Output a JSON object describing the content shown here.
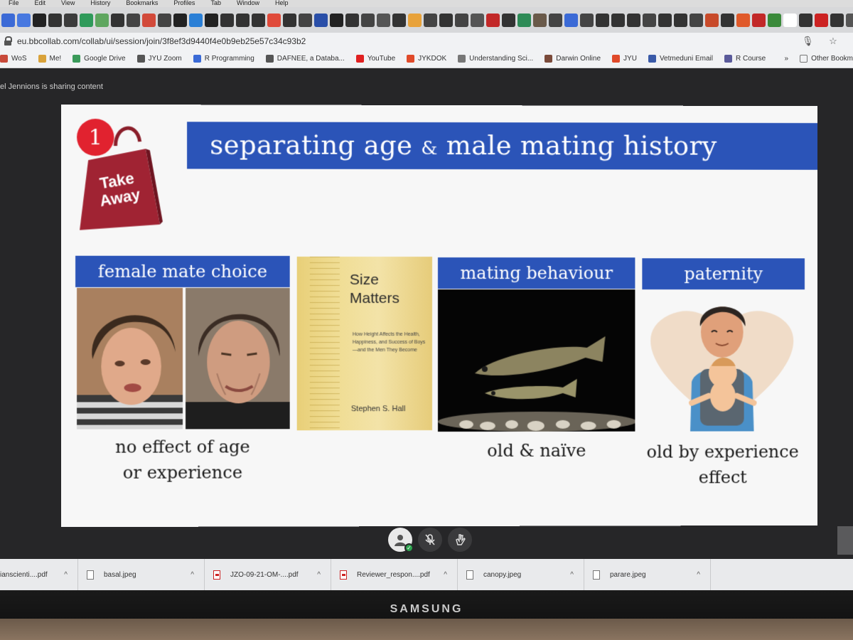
{
  "menubar": [
    "File",
    "Edit",
    "View",
    "History",
    "Bookmarks",
    "Profiles",
    "Tab",
    "Window",
    "Help"
  ],
  "tab_colors": [
    "#3b6ad6",
    "#4778e0",
    "#222222",
    "#333333",
    "#3c3c3c",
    "#2f9a5a",
    "#5fa65f",
    "#333333",
    "#444444",
    "#d24a3a",
    "#444444",
    "#222222",
    "#2a7fd6",
    "#222222",
    "#333333",
    "#333333",
    "#333333",
    "#e04a3a",
    "#333333",
    "#444444",
    "#2a4fa8",
    "#222222",
    "#333333",
    "#444444",
    "#555555",
    "#333333",
    "#e8a23a",
    "#444444",
    "#333333",
    "#444444",
    "#555555",
    "#c22828",
    "#333333",
    "#2e8b57",
    "#6a5a4a",
    "#444444",
    "#3b6ad6",
    "#444444",
    "#333333",
    "#333333",
    "#333333",
    "#444444",
    "#333333",
    "#333333",
    "#444444",
    "#c84a2a",
    "#333333",
    "#e05a2a",
    "#c22828",
    "#3a8a3a",
    "#ffffff",
    "#333333",
    "#cc2222",
    "#333333",
    "#555555",
    "#333333",
    "#333333",
    "#333333",
    "#cc3333",
    "#e2c22a",
    "#333333",
    "#2a88d6",
    "#333333",
    "#3a6ad6",
    "#e2c22a",
    "#cc3333",
    "#3a6ad6",
    "#333333"
  ],
  "address": {
    "url": "eu.bbcollab.com/collab/ui/session/join/3f8ef3d9440f4e0b9eb25e57c34c93b2"
  },
  "bookmarks": [
    {
      "label": "WoS",
      "color": "#c84a3a"
    },
    {
      "label": "Me!",
      "color": "#d9a23a"
    },
    {
      "label": "Google Drive",
      "color": "#3a9a5a"
    },
    {
      "label": "JYU Zoom",
      "color": "#555555"
    },
    {
      "label": "R Programming",
      "color": "#3a6ad6"
    },
    {
      "label": "DAFNEE, a Databa...",
      "color": "#555555"
    },
    {
      "label": "YouTube",
      "color": "#e02020"
    },
    {
      "label": "JYKDOK",
      "color": "#e04a2a"
    },
    {
      "label": "Understanding Sci...",
      "color": "#777777"
    },
    {
      "label": "Darwin Online",
      "color": "#7a4a3a"
    },
    {
      "label": "JYU",
      "color": "#e04a2a"
    },
    {
      "label": "Vetmeduni Email",
      "color": "#3a5aa8"
    },
    {
      "label": "R Course",
      "color": "#5a5a9a"
    }
  ],
  "bookmarks_overflow": "»",
  "other_bookmarks": "Other Bookm",
  "sharing_text": "el Jennions is sharing content",
  "slide": {
    "title_pre": "separating age ",
    "title_amp": "&",
    "title_post": " male mating history",
    "badge_number": "1",
    "bag_line1": "Take",
    "bag_line2": "Away",
    "sec_female": "female mate choice",
    "sec_mating": "mating behaviour",
    "sec_paternity": "paternity",
    "cap_female_1": "no effect of age",
    "cap_female_2": "or experience",
    "cap_mating": "old & naïve",
    "cap_paternity_1": "old by experience",
    "cap_paternity_2": "effect",
    "book_title_1": "Size",
    "book_title_2": "Matters",
    "book_subtitle": "How Height Affects the Health, Happiness, and Success of Boys—and the Men They Become",
    "book_author": "Stephen S. Hall"
  },
  "downloads": [
    {
      "name": "ianscienti....pdf",
      "type": "pdf"
    },
    {
      "name": "basal.jpeg",
      "type": "jpeg"
    },
    {
      "name": "JZO-09-21-OM-....pdf",
      "type": "pdf"
    },
    {
      "name": "Reviewer_respon....pdf",
      "type": "pdf"
    },
    {
      "name": "canopy.jpeg",
      "type": "jpeg"
    },
    {
      "name": "parare.jpeg",
      "type": "jpeg"
    }
  ],
  "monitor_brand": "SAMSUNG"
}
